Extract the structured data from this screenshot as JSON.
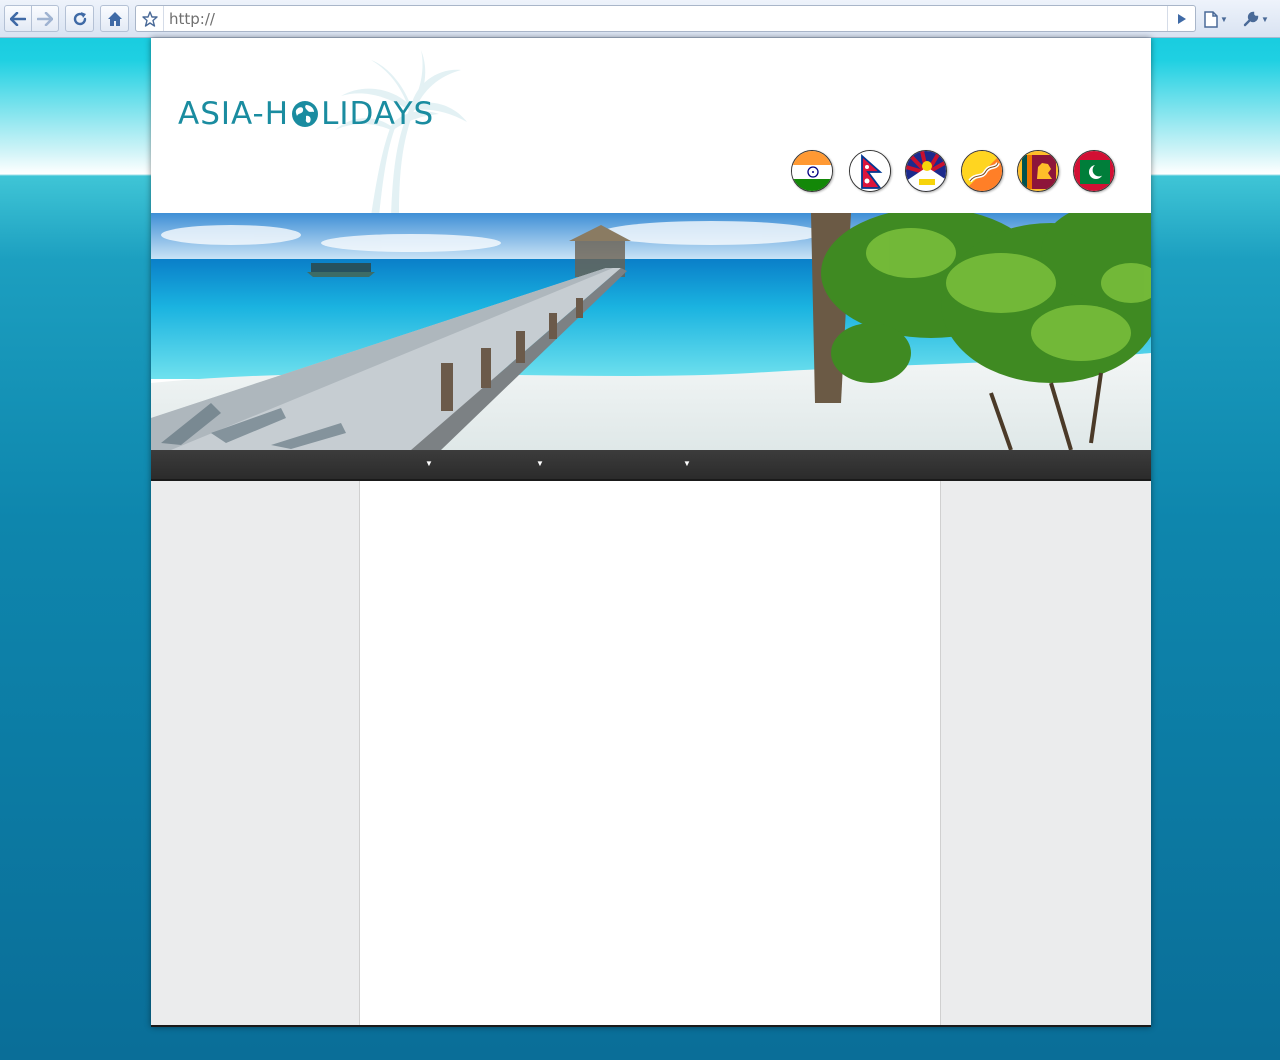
{
  "browser": {
    "url": "http://",
    "icons": {
      "back": "back-arrow-icon",
      "forward": "forward-arrow-icon",
      "reload": "reload-icon",
      "home": "home-icon",
      "bookmark": "star-icon",
      "go": "play-icon",
      "page": "page-icon",
      "tools": "wrench-icon"
    }
  },
  "site": {
    "logo_before": "ASIA-H",
    "logo_after": "LIDAYS",
    "flags": [
      {
        "country": "India",
        "icon": "india-flag-icon"
      },
      {
        "country": "Nepal",
        "icon": "nepal-flag-icon"
      },
      {
        "country": "Tibet",
        "icon": "tibet-flag-icon"
      },
      {
        "country": "Bhutan",
        "icon": "bhutan-flag-icon"
      },
      {
        "country": "Sri Lanka",
        "icon": "sri-lanka-flag-icon"
      },
      {
        "country": "Maldives",
        "icon": "maldives-flag-icon"
      }
    ],
    "menu": {
      "arrow_1": "▼",
      "arrow_2": "▼",
      "arrow_3": "▼"
    }
  },
  "colors": {
    "logo": "#1a8ca0",
    "menubar": "#2f2f2f",
    "sidebar": "#ebeced",
    "page_bg_top": "#0fc6dc",
    "page_bg_bottom": "#0a6e98"
  }
}
